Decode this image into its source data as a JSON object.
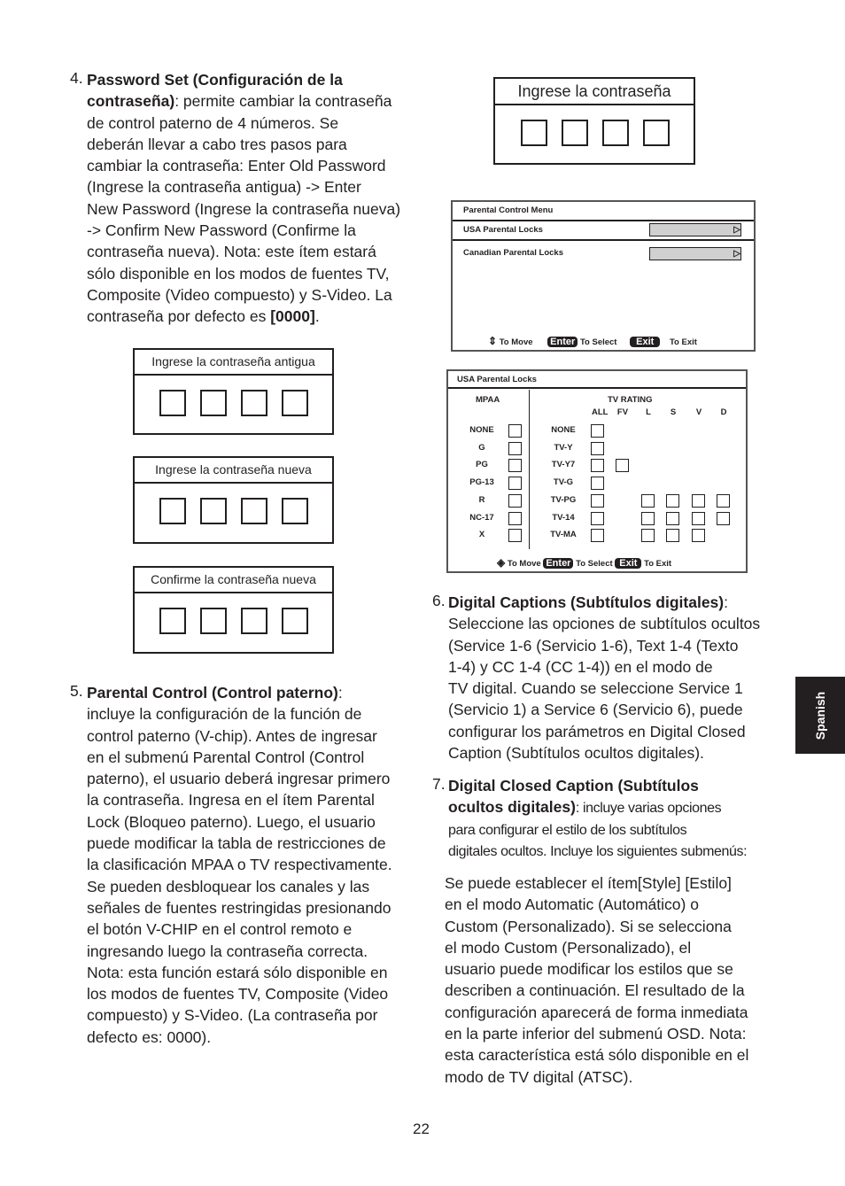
{
  "item4": {
    "num": "4.",
    "lines": [
      {
        "b": "Password Set (Configuración de la",
        "t": ""
      },
      {
        "b": "contraseña)",
        "t": ": permite cambiar la contraseña"
      },
      {
        "t": "de control paterno de 4 números. Se"
      },
      {
        "t": "deberán llevar a cabo tres pasos para"
      },
      {
        "t": "cambiar la contraseña: Enter Old Password"
      },
      {
        "t": "(Ingrese la contraseña antigua) -> Enter"
      },
      {
        "t": "New Password (Ingrese la contraseña nueva)"
      },
      {
        "t": "-> Confirm New Password (Confirme la"
      },
      {
        "t": "contraseña nueva). Nota: este ítem estará"
      },
      {
        "t": "sólo disponible en los modos de fuentes TV,"
      },
      {
        "t": "Composite (Video compuesto) y S-Video. La"
      },
      {
        "t": "contraseña por defecto es ",
        "b2": "[0000]",
        "t2": "."
      }
    ]
  },
  "item5": {
    "num": "5.",
    "lines": [
      {
        "b": "Parental Control (Control paterno)",
        "t": ":"
      },
      {
        "t": "incluye la configuración de la función de"
      },
      {
        "t": "control paterno (V-chip). Antes de ingresar"
      },
      {
        "t": "en el submenú Parental Control (Control"
      },
      {
        "t": "paterno), el usuario deberá ingresar primero"
      },
      {
        "t": "la contraseña. Ingresa en el ítem Parental"
      },
      {
        "t": "Lock (Bloqueo paterno). Luego, el usuario"
      },
      {
        "t": "puede modificar la tabla de restricciones de"
      },
      {
        "t": "la clasificación MPAA o TV respectivamente."
      },
      {
        "t": "Se pueden desbloquear los canales y las"
      },
      {
        "t": "señales de fuentes restringidas presionando"
      },
      {
        "t": "el botón V-CHIP en el control remoto e"
      },
      {
        "t": "ingresando luego la contraseña correcta."
      },
      {
        "t": "Nota: esta función estará sólo disponible en"
      },
      {
        "t": "los modos de fuentes TV, Composite (Video"
      },
      {
        "t": "compuesto) y S-Video. (La contraseña por"
      },
      {
        "t": "defecto es: 0000)."
      }
    ]
  },
  "item6": {
    "num": "6.",
    "lines": [
      {
        "b": "Digital Captions (Subtítulos digitales)",
        "t": ":"
      },
      {
        "t": "Seleccione las opciones de subtítulos ocultos"
      },
      {
        "t": "(Service 1-6 (Servicio 1-6), Text 1-4 (Texto"
      },
      {
        "t": "1-4) y CC 1-4 (CC 1-4)) en el modo de"
      },
      {
        "t": "TV digital. Cuando se seleccione Service 1"
      },
      {
        "t": "(Servicio 1) a Service 6 (Servicio 6), puede"
      },
      {
        "t": "configurar los parámetros en Digital Closed"
      },
      {
        "t": "Caption (Subtítulos ocultos digitales)."
      }
    ]
  },
  "item7": {
    "num": "7.",
    "lines": [
      {
        "b": "Digital Closed Caption (Subtítulos",
        "t": ""
      },
      {
        "b": "ocultos digitales)",
        "s": ": incluye varias opciones"
      },
      {
        "s": "para configurar el estilo de los subtítulos"
      },
      {
        "s": "digitales ocultos. Incluye los siguientes submenús:"
      }
    ]
  },
  "item7b": {
    "lines": [
      {
        "t": "Se puede establecer el ítem[Style] [Estilo]"
      },
      {
        "t": " en el modo Automatic (Automático) o"
      },
      {
        "t": " Custom (Personalizado). Si se selecciona"
      },
      {
        "t": " el modo Custom (Personalizado), el"
      },
      {
        "t": " usuario puede modificar los estilos que se"
      },
      {
        "t": " describen a continuación. El resultado de la"
      },
      {
        "t": " configuración aparecerá de forma inmediata"
      },
      {
        "t": " en la parte inferior del submenú OSD. Nota:"
      },
      {
        "t": " esta característica está sólo disponible en el"
      },
      {
        "t": " modo de TV digital (ATSC)."
      }
    ]
  },
  "password_boxes": {
    "enter": "Ingrese la contraseña",
    "old": "Ingrese la contraseña antigua",
    "new": "Ingrese la contraseña nueva",
    "confirm": "Confirme la contraseña nueva"
  },
  "parental_menu": {
    "title": "Parental Control Menu",
    "items": [
      "USA Parental Locks",
      "Canadian Parental Locks"
    ],
    "footer": {
      "move": "To Move",
      "enter": "Enter",
      "select": "To Select",
      "exit": "Exit",
      "to_exit": "To Exit"
    }
  },
  "usa_locks": {
    "title": "USA Parental Locks",
    "mpaa_header": "MPAA",
    "tv_header": "TV RATING",
    "columns": [
      "ALL",
      "FV",
      "L",
      "S",
      "V",
      "D"
    ],
    "mpaa": [
      "NONE",
      "G",
      "PG",
      "PG-13",
      "R",
      "NC-17",
      "X"
    ],
    "tv": [
      "NONE",
      "TV-Y",
      "TV-Y7",
      "TV-G",
      "TV-PG",
      "TV-14",
      "TV-MA"
    ],
    "footer": {
      "move": "To Move",
      "enter": "Enter",
      "select": "To Select",
      "exit": "Exit",
      "to_exit": "To Exit"
    }
  },
  "side_tab": "Spanish",
  "page_number": "22"
}
